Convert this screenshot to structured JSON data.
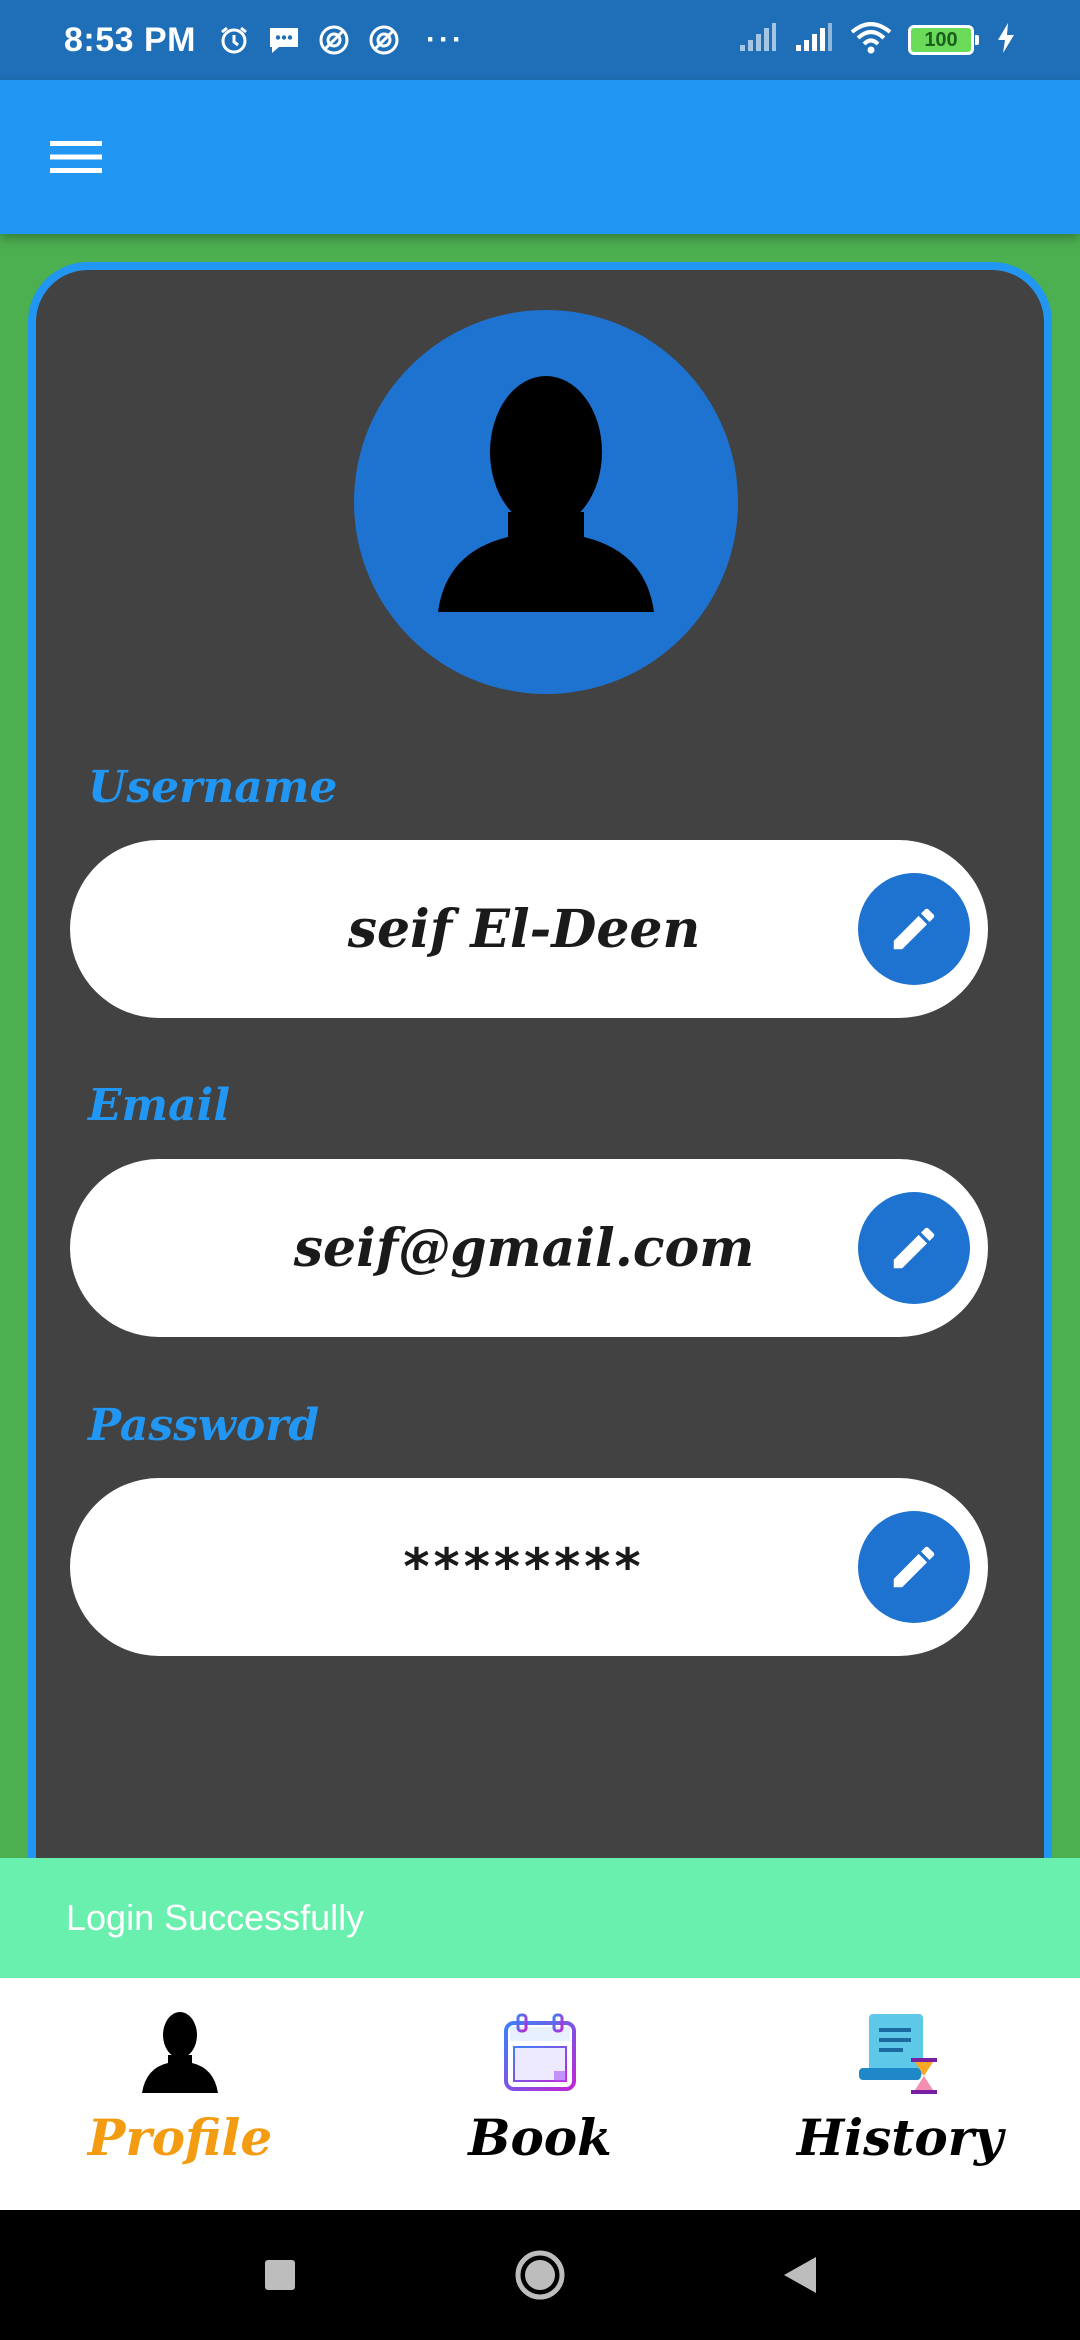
{
  "status_bar": {
    "time": "8:53 PM",
    "dots": "···",
    "battery": "100",
    "icons": [
      "alarm-icon",
      "message-icon",
      "sync-icon",
      "sync-icon",
      "signal-icon",
      "signal-icon",
      "wifi-icon",
      "battery-icon",
      "charging-icon"
    ]
  },
  "app_bar": {
    "menu_icon": "menu-icon",
    "color": "#2196f3"
  },
  "profile": {
    "avatar_icon": "person-icon",
    "fields": [
      {
        "label": "Username",
        "value": "seif El-Deen",
        "edit_icon": "pencil-icon"
      },
      {
        "label": "Email",
        "value": "seif@gmail.com",
        "edit_icon": "pencil-icon"
      },
      {
        "label": "Password",
        "value": "********",
        "edit_icon": "pencil-icon"
      }
    ]
  },
  "snackbar": {
    "message": "Login Successfully",
    "color": "#69f0ae"
  },
  "bottom_nav": {
    "active_color": "#f39c12",
    "items": [
      {
        "label": "Profile",
        "icon": "person-icon",
        "active": true
      },
      {
        "label": "Book",
        "icon": "calendar-icon",
        "active": false
      },
      {
        "label": "History",
        "icon": "history-icon",
        "active": false
      }
    ]
  },
  "system_nav": [
    "recents-icon",
    "home-icon",
    "back-icon"
  ]
}
